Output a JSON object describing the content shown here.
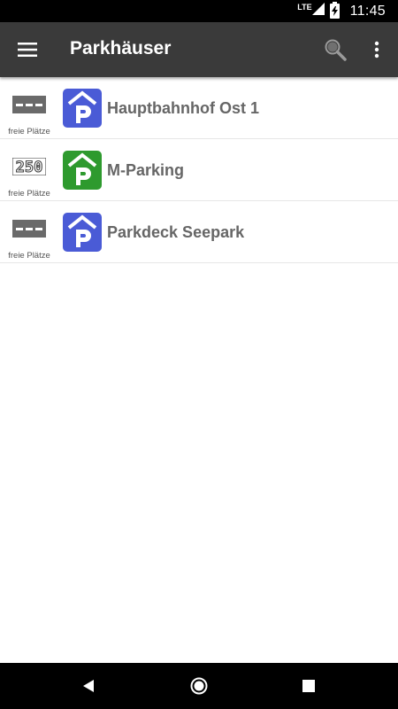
{
  "status_bar": {
    "network": "LTE",
    "time": "11:45",
    "icons": [
      "signal-icon",
      "battery-charging-icon"
    ]
  },
  "app_bar": {
    "title": "Parkhäuser",
    "icons": [
      "menu-icon",
      "search-icon",
      "more-vert-icon"
    ]
  },
  "colors": {
    "app_bar": "#3a3a3a",
    "logo_blue": "#4a5bd6",
    "logo_green": "#2e9a2e",
    "name_text": "#666666"
  },
  "parking_list": [
    {
      "name": "Hauptbahnhof Ost 1",
      "free_display": "---",
      "free_label": "freie Plätze",
      "logo_color": "blue"
    },
    {
      "name": "M-Parking",
      "free_display": "250",
      "free_label": "freie Plätze",
      "logo_color": "green"
    },
    {
      "name": "Parkdeck Seepark",
      "free_display": "---",
      "free_label": "freie Plätze",
      "logo_color": "blue"
    }
  ],
  "nav_bar": {
    "icons": [
      "back-icon",
      "home-icon",
      "recents-icon"
    ]
  }
}
